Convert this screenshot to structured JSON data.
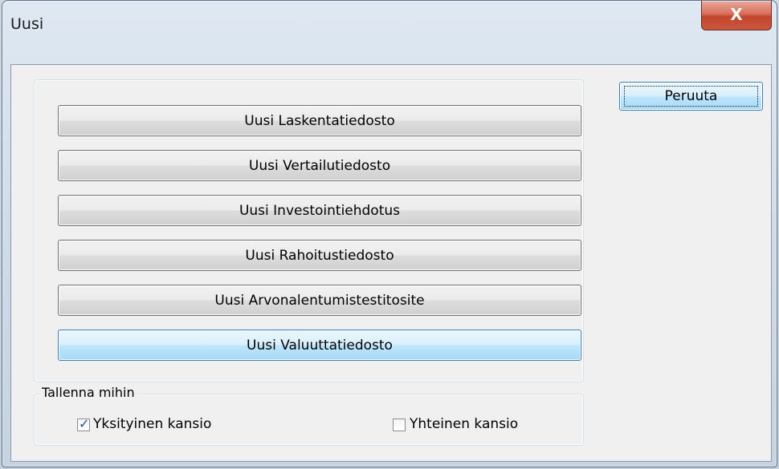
{
  "window": {
    "title": "Uusi",
    "close_glyph": "X"
  },
  "buttons": [
    {
      "label": "Uusi Laskentatiedosto"
    },
    {
      "label": "Uusi Vertailutiedosto"
    },
    {
      "label": "Uusi Investointiehdotus"
    },
    {
      "label": "Uusi Rahoitustiedosto"
    },
    {
      "label": "Uusi Arvonalentumistestitosite"
    },
    {
      "label": "Uusi Valuuttatiedosto"
    }
  ],
  "cancel_label": "Peruuta",
  "save_group": {
    "legend": "Tallenna mihin",
    "private": {
      "label": "Yksityinen kansio",
      "checked": true
    },
    "shared": {
      "label": "Yhteinen kansio",
      "checked": false
    }
  },
  "colors": {
    "accent": "#3c7fb1",
    "close": "#c2452c",
    "check": "#2a4d9b"
  },
  "icons": {
    "close": "close-icon",
    "check": "checkmark-icon"
  }
}
